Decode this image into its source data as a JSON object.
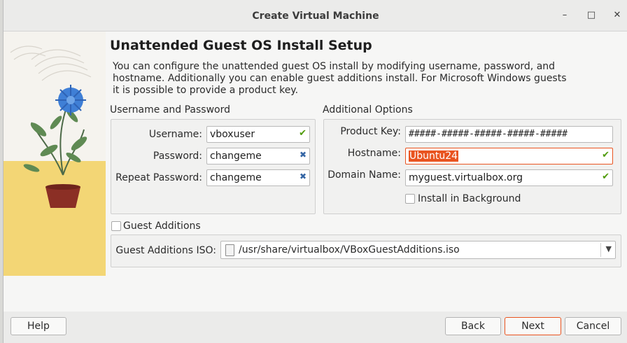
{
  "window": {
    "title": "Create Virtual Machine",
    "minimize_glyph": "–",
    "maximize_glyph": "□",
    "close_glyph": "✕"
  },
  "heading": "Unattended Guest OS Install Setup",
  "description": "You can configure the unattended guest OS install by modifying username, password, and hostname. Additionally you can enable guest additions install. For Microsoft Windows guests it is possible to provide a product key.",
  "user_group": {
    "title": "Username and Password",
    "username_label": "Username:",
    "username_value": "vboxuser",
    "password_label": "Password:",
    "password_value": "changeme",
    "repeat_label": "Repeat Password:",
    "repeat_value": "changeme"
  },
  "additional": {
    "title": "Additional Options",
    "product_key_label": "Product Key:",
    "product_key_value": "#####-#####-#####-#####-#####",
    "hostname_label": "Hostname:",
    "hostname_value": "Ubuntu24",
    "domain_label": "Domain Name:",
    "domain_value": "myguest.virtualbox.org",
    "install_bg_label": "Install in Background",
    "install_bg_checked": false
  },
  "guest_additions": {
    "checkbox_label": "Guest Additions",
    "checked": false,
    "iso_label": "Guest Additions ISO:",
    "iso_value": "/usr/share/virtualbox/VBoxGuestAdditions.iso"
  },
  "buttons": {
    "help": "Help",
    "back": "Back",
    "next": "Next",
    "cancel": "Cancel"
  },
  "colors": {
    "accent": "#e95420",
    "valid": "#4e9a06",
    "illustration_floor": "#f3d675"
  }
}
